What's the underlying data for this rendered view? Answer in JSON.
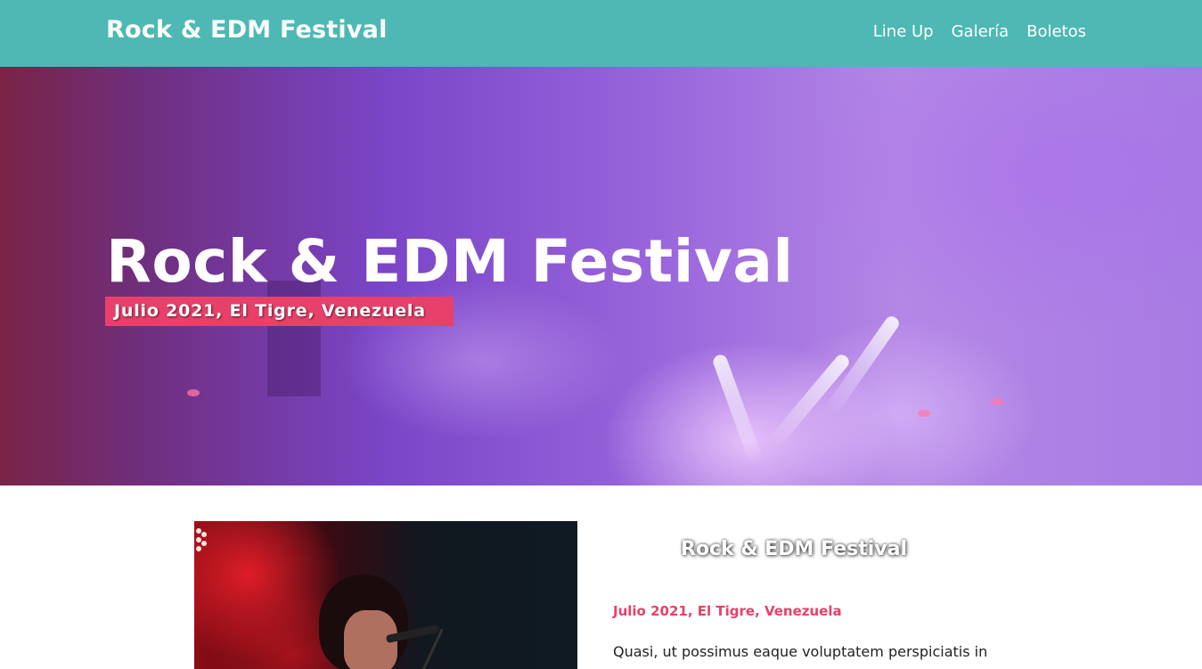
{
  "header": {
    "brand": "Rock & EDM Festival",
    "nav": [
      {
        "label": "Line Up"
      },
      {
        "label": "Galería"
      },
      {
        "label": "Boletos"
      }
    ],
    "background_color": "#4db8b4"
  },
  "hero": {
    "title": "Rock & EDM Festival",
    "subtitle": "Julio 2021, El Tigre, Venezuela",
    "badge_color": "#e8406a"
  },
  "content": {
    "title": "Rock & EDM Festival",
    "date": "Julio 2021, El Tigre, Venezuela",
    "text": "Quasi, ut possimus eaque voluptatem perspiciatis in"
  }
}
